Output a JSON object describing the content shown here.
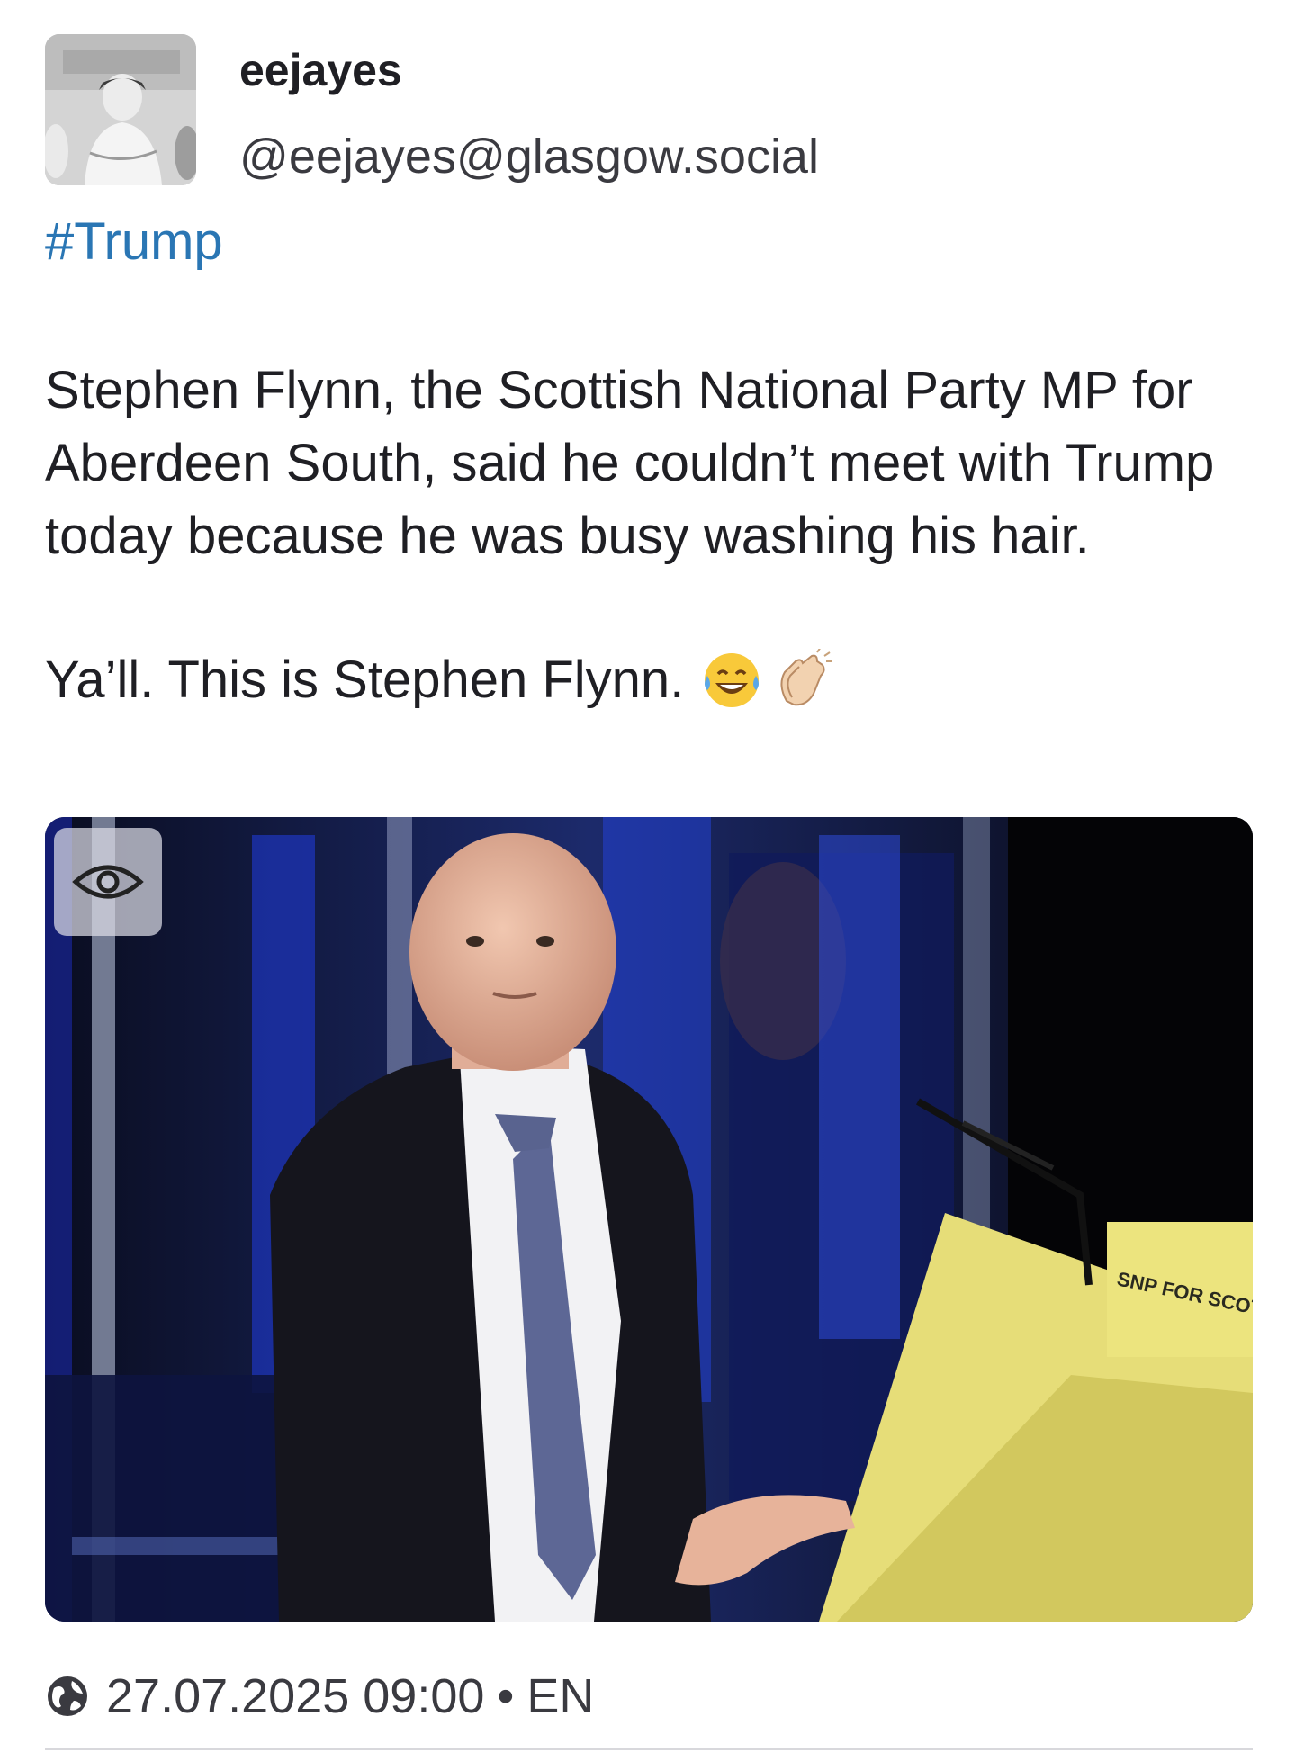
{
  "author": {
    "display_name": "eejayes",
    "handle": "@eejayes@glasgow.social"
  },
  "post": {
    "hashtag": "#Trump",
    "paragraph_1": "Stephen Flynn, the Scottish National Party MP for Aberdeen South, said he couldn’t meet with Trump today because he was busy washing his hair.",
    "paragraph_2": "Ya’ll. This is Stephen Flynn.",
    "emojis": [
      "face-with-tears-of-joy",
      "clapping-hands"
    ]
  },
  "media": {
    "podium_sign": "SNP FOR SCOTLAND",
    "reveal_icon": "eye-icon"
  },
  "footer": {
    "icon": "globe-icon",
    "timestamp": "27.07.2025 09:00",
    "separator": "•",
    "language": "EN"
  },
  "colors": {
    "hashtag": "#2a76b4",
    "text": "#1f1f24",
    "podium": "#e8e07a",
    "stage_background": "#0b0f2b"
  }
}
